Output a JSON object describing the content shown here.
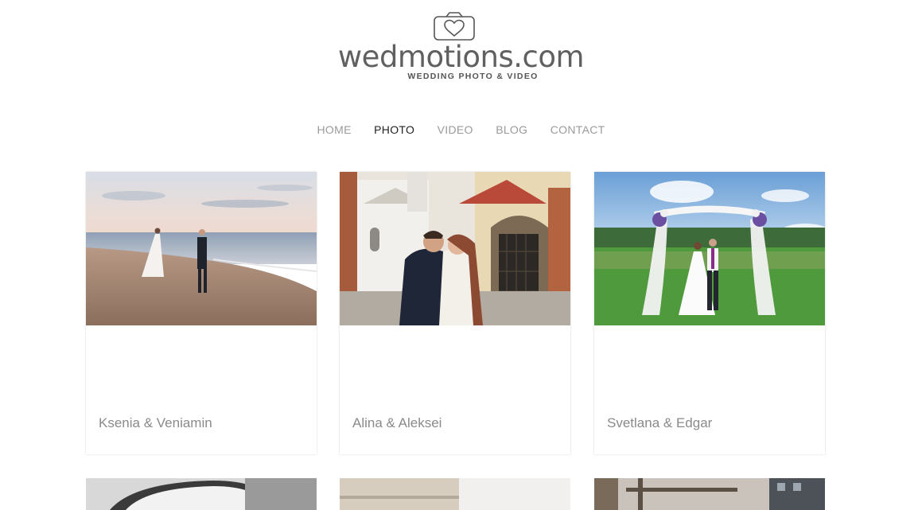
{
  "logo": {
    "name": "wedmotions.com",
    "tagline": "WEDDING PHOTO & VIDEO"
  },
  "nav": {
    "items": [
      {
        "label": "HOME",
        "active": false
      },
      {
        "label": "PHOTO",
        "active": true
      },
      {
        "label": "VIDEO",
        "active": false
      },
      {
        "label": "BLOG",
        "active": false
      },
      {
        "label": "CONTACT",
        "active": false
      }
    ]
  },
  "gallery": {
    "cards": [
      {
        "title": "Ksenia & Veniamin"
      },
      {
        "title": "Alina & Aleksei"
      },
      {
        "title": "Svetlana & Edgar"
      }
    ]
  },
  "colors": {
    "nav_inactive": "#9a9a9a",
    "nav_active": "#222222",
    "logo_text": "#606060"
  }
}
